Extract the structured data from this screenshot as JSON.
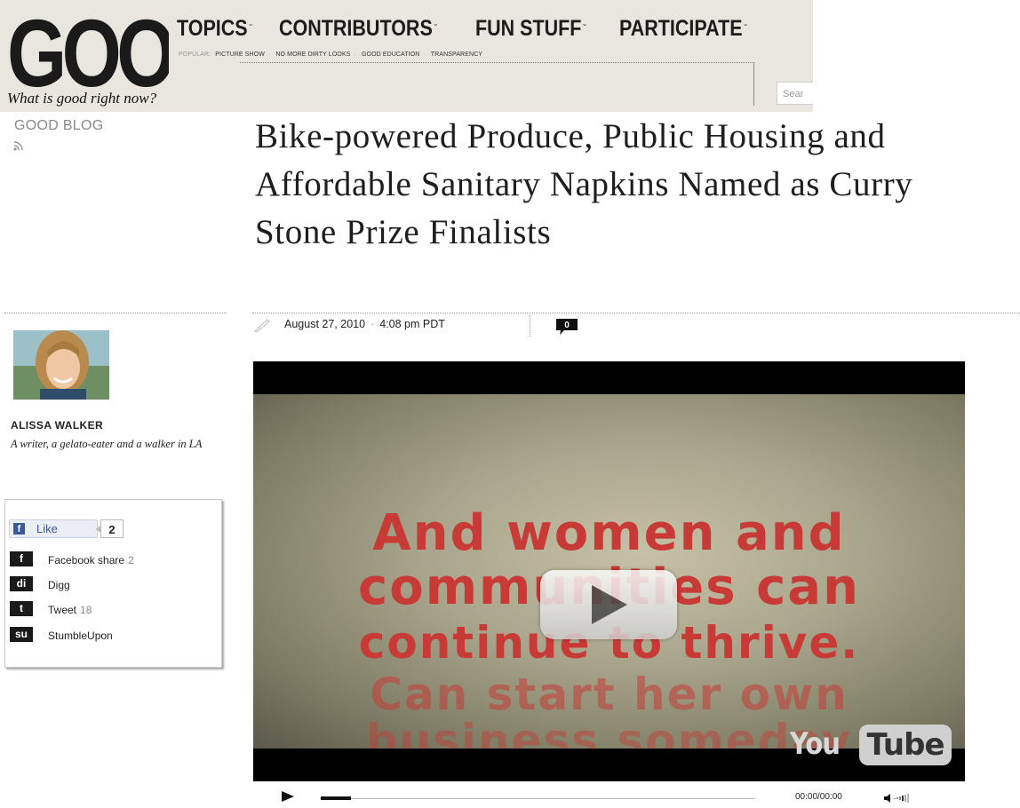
{
  "header": {
    "logo": "GOOD",
    "tagline": "What is good right now?",
    "nav": [
      {
        "label": "TOPICS"
      },
      {
        "label": "CONTRIBUTORS"
      },
      {
        "label": "FUN STUFF"
      },
      {
        "label": "PARTICIPATE"
      }
    ],
    "popular_label": "POPULAR:",
    "popular_links": [
      "PICTURE SHOW",
      "NO MORE DIRTY LOOKS",
      "GOOD EDUCATION",
      "TRANSPARENCY"
    ],
    "search_placeholder": "Sear"
  },
  "sidebar": {
    "blog_label": "GOOD BLOG",
    "author_name": "ALISSA WALKER",
    "author_bio": "A writer, a gelato-eater and a walker in LA",
    "share": {
      "like_label": "Like",
      "like_count": "2",
      "items": [
        {
          "icon": "facebook-icon",
          "label": "Facebook share",
          "count": "2"
        },
        {
          "icon": "digg-icon",
          "label": "Digg",
          "count": ""
        },
        {
          "icon": "twitter-icon",
          "label": "Tweet",
          "count": "18"
        },
        {
          "icon": "stumbleupon-icon",
          "label": "StumbleUpon",
          "count": ""
        }
      ]
    }
  },
  "article": {
    "title": "Bike-powered Produce, Public Housing and Affordable Sanitary Napkins Named as Curry Stone Prize Finalists",
    "date": "August 27, 2010",
    "time": "4:08 pm PDT",
    "comment_count": "0"
  },
  "video": {
    "lines": [
      "And women and",
      "communities can",
      "continue to thrive.",
      "Can start her own",
      "business someday"
    ],
    "brand_you": "You",
    "brand_tube": "Tube",
    "time": "00:00/00:00",
    "progress": 0.07
  }
}
